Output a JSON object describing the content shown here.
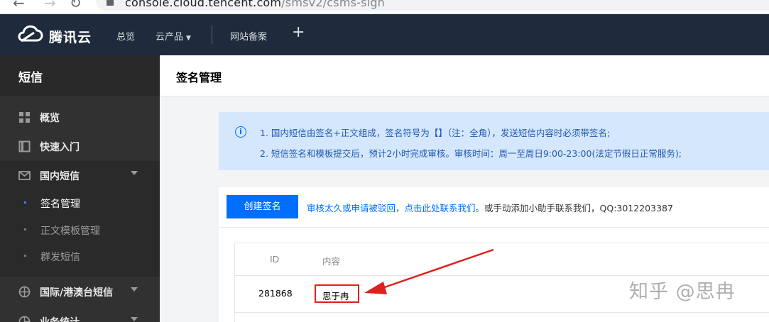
{
  "browser": {
    "url_host": "console.cloud.tencent.com",
    "url_path": "/smsv2/csms-sign"
  },
  "topnav": {
    "brand": "腾讯云",
    "overview": "总览",
    "products": "云产品",
    "filing": "网站备案",
    "plus": "+"
  },
  "sidebar": {
    "title": "短信",
    "items": [
      {
        "label": "概览"
      },
      {
        "label": "快速入门"
      },
      {
        "label": "国内短信"
      },
      {
        "label": "国际/港澳台短信"
      },
      {
        "label": "业务统计"
      }
    ],
    "sub_items": [
      {
        "label": "签名管理"
      },
      {
        "label": "正文模板管理"
      },
      {
        "label": "群发短信"
      }
    ]
  },
  "main": {
    "title": "签名管理",
    "notice_lines": [
      "1. 国内短信由签名+正文组成，签名符号为【】（注：全角），发送短信内容时必须带签名;",
      "2. 短信签名和模板提交后，预计2小时完成审核。审核时间：周一至周日9:00-23:00(法定节假日正常服务);"
    ],
    "create_button": "创建签名",
    "tip_link": "审核太久或申请被驳回，点击此处联系我们。",
    "tip_text": "或手动添加小助手联系我们，QQ:3012203387",
    "table": {
      "headers": [
        "ID",
        "内容"
      ],
      "rows": [
        {
          "id": "281868",
          "content": "思于冉"
        }
      ]
    }
  },
  "watermark": "知乎 @思冉",
  "colors": {
    "nav_bg": "#1f2b3c",
    "sidebar_bg": "#313131",
    "accent": "#006eff",
    "highlight": "#e0201c"
  }
}
